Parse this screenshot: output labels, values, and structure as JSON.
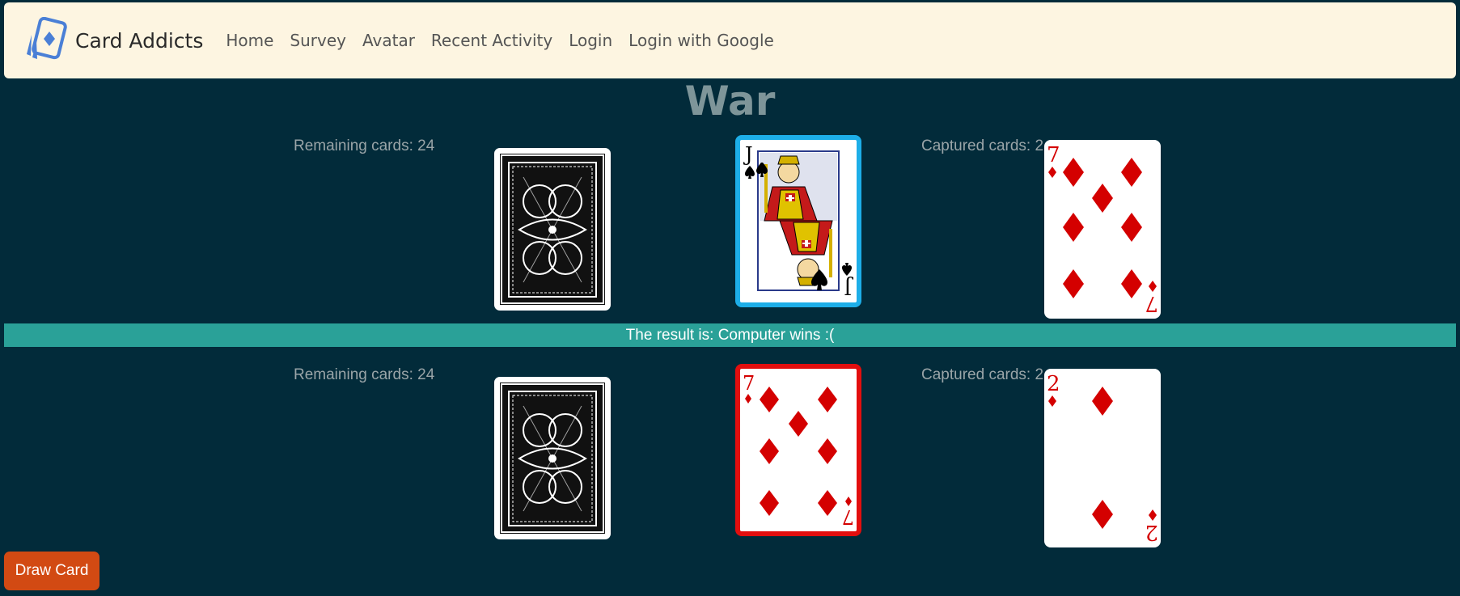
{
  "nav": {
    "brand": "Card Addicts",
    "links": [
      "Home",
      "Survey",
      "Avatar",
      "Recent Activity",
      "Login",
      "Login with Google"
    ]
  },
  "title": "War",
  "computer": {
    "remaining_label": "Remaining cards: 24",
    "captured_label": "Captured cards: 2",
    "played_card": {
      "rank": "J",
      "suit": "spades",
      "frame": "blue"
    },
    "captured_top_card": {
      "rank": "7",
      "suit": "diamonds"
    }
  },
  "result": "The result is: Computer wins :(",
  "player": {
    "remaining_label": "Remaining cards: 24",
    "captured_label": "Captured cards: 2",
    "played_card": {
      "rank": "7",
      "suit": "diamonds",
      "frame": "red"
    },
    "captured_top_card": {
      "rank": "2",
      "suit": "diamonds"
    }
  },
  "draw_button": "Draw Card",
  "colors": {
    "background": "#022b3a",
    "navbar": "#fdf5e1",
    "result_bar": "#2aa198",
    "button": "#d24a13",
    "frame_blue": "#1daee8",
    "frame_red": "#e30e0e",
    "diamond_red": "#d40000"
  }
}
